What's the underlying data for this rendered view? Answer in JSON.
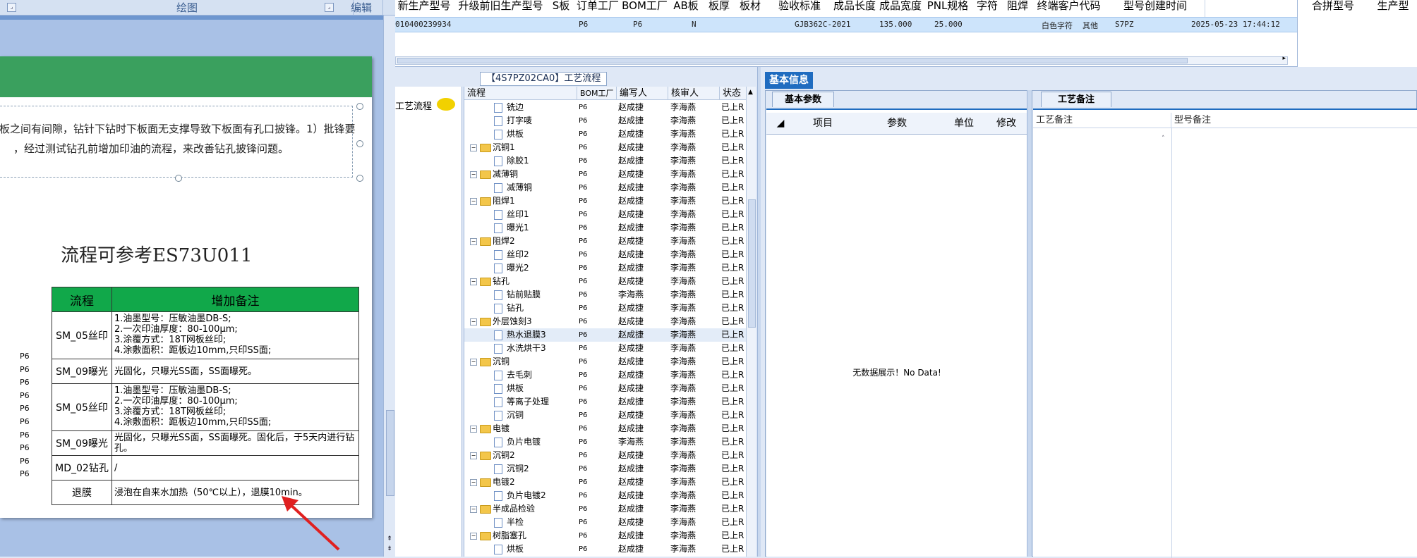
{
  "ribbon": {
    "group_draw": "绘图",
    "group_edit": "编辑"
  },
  "document": {
    "textbox_line1": "板之间有间隙，钻针下钻时下板面无支撑导致下板面有孔口披锋。1）批锋要",
    "textbox_line2": "，经过测试钻孔前增加印油的流程，来改善钻孔披锋问题。",
    "flow_reference": "流程可参考ES73U011",
    "table_headers": {
      "step": "流程",
      "note": "增加备注"
    },
    "table_rows": [
      {
        "step": "SM_05丝印",
        "lines": [
          "1.油墨型号：压敏油墨DB-S;",
          "2.一次印油厚度：80-100μm;",
          "3.涂覆方式：18T网板丝印;",
          "4.涂敷面积：距板边10mm,只印SS面;"
        ]
      },
      {
        "step": "SM_09曝光",
        "lines": [
          "光固化，只曝光SS面，SS面曝死。"
        ]
      },
      {
        "step": "SM_05丝印",
        "lines": [
          "1.油墨型号：压敏油墨DB-S;",
          "2.一次印油厚度：80-100μm;",
          "3.涂覆方式：18T网板丝印;",
          "4.涂敷面积：距板边10mm,只印SS面;"
        ]
      },
      {
        "step": "SM_09曝光",
        "lines": [
          "光固化，只曝光SS面，SS面曝死。固化后，于5天内进行钻孔。"
        ]
      },
      {
        "step": "MD_02钻孔",
        "lines": [
          "/"
        ]
      },
      {
        "step": "退膜",
        "lines": [
          "浸泡在自来水加热（50℃以上），退膜10min。"
        ]
      }
    ],
    "left_p6_values": [
      "P6",
      "P6",
      "P6",
      "P6",
      "P6",
      "P6",
      "P6",
      "P6",
      "P6",
      "P6"
    ]
  },
  "top_grid": {
    "headers": [
      "新生产型号",
      "升级前旧生产型号",
      "S板",
      "订单工厂",
      "BOM工厂",
      "AB板",
      "板厚",
      "板材",
      "验收标准",
      "成品长度",
      "成品宽度",
      "PNL规格",
      "字符",
      "阻焊",
      "终端客户代码",
      "型号创建时间"
    ],
    "row": {
      "new_model": "010400239934",
      "order_factory": "P6",
      "bom_factory": "P6",
      "ab": "N",
      "standard": "GJB362C-2021",
      "length": "135.000",
      "width": "25.000",
      "char": "白色字符",
      "solder": "其他",
      "customer": "S7PZ",
      "created": "2025-05-23 17:44:12"
    },
    "side_headers": [
      "合拼型号",
      "生产型"
    ]
  },
  "tree": {
    "title": "【4S7PZ02CA0】工艺流程",
    "left_label": "工艺流程",
    "headers": [
      "流程",
      "BOM工厂",
      "编写人",
      "核审人",
      "状态"
    ],
    "rows": [
      {
        "level": 2,
        "type": "file",
        "name": "铣边",
        "bom": "P6",
        "writer": "赵成捷",
        "reviewer": "李海燕",
        "status": "已上R"
      },
      {
        "level": 2,
        "type": "file",
        "name": "打字唛",
        "bom": "P6",
        "writer": "赵成捷",
        "reviewer": "李海燕",
        "status": "已上R"
      },
      {
        "level": 2,
        "type": "file",
        "name": "烘板",
        "bom": "P6",
        "writer": "赵成捷",
        "reviewer": "李海燕",
        "status": "已上R"
      },
      {
        "level": 1,
        "type": "folder",
        "name": "沉铜1",
        "bom": "P6",
        "writer": "赵成捷",
        "reviewer": "李海燕",
        "status": "已上R"
      },
      {
        "level": 2,
        "type": "file",
        "name": "除胶1",
        "bom": "P6",
        "writer": "赵成捷",
        "reviewer": "李海燕",
        "status": "已上R"
      },
      {
        "level": 1,
        "type": "folder",
        "name": "减薄铜",
        "bom": "P6",
        "writer": "赵成捷",
        "reviewer": "李海燕",
        "status": "已上R"
      },
      {
        "level": 2,
        "type": "file",
        "name": "减薄铜",
        "bom": "P6",
        "writer": "赵成捷",
        "reviewer": "李海燕",
        "status": "已上R"
      },
      {
        "level": 1,
        "type": "folder",
        "name": "阻焊1",
        "bom": "P6",
        "writer": "赵成捷",
        "reviewer": "李海燕",
        "status": "已上R"
      },
      {
        "level": 2,
        "type": "file",
        "name": "丝印1",
        "bom": "P6",
        "writer": "赵成捷",
        "reviewer": "李海燕",
        "status": "已上R"
      },
      {
        "level": 2,
        "type": "file",
        "name": "曝光1",
        "bom": "P6",
        "writer": "赵成捷",
        "reviewer": "李海燕",
        "status": "已上R"
      },
      {
        "level": 1,
        "type": "folder",
        "name": "阻焊2",
        "bom": "P6",
        "writer": "赵成捷",
        "reviewer": "李海燕",
        "status": "已上R"
      },
      {
        "level": 2,
        "type": "file",
        "name": "丝印2",
        "bom": "P6",
        "writer": "赵成捷",
        "reviewer": "李海燕",
        "status": "已上R"
      },
      {
        "level": 2,
        "type": "file",
        "name": "曝光2",
        "bom": "P6",
        "writer": "赵成捷",
        "reviewer": "李海燕",
        "status": "已上R"
      },
      {
        "level": 1,
        "type": "folder",
        "name": "钻孔",
        "bom": "P6",
        "writer": "赵成捷",
        "reviewer": "李海燕",
        "status": "已上R"
      },
      {
        "level": 2,
        "type": "file",
        "name": "钻前贴膜",
        "bom": "P6",
        "writer": "李海燕",
        "reviewer": "李海燕",
        "status": "已上R"
      },
      {
        "level": 2,
        "type": "file",
        "name": "钻孔",
        "bom": "P6",
        "writer": "赵成捷",
        "reviewer": "李海燕",
        "status": "已上R"
      },
      {
        "level": 1,
        "type": "folder",
        "name": "外层蚀刻3",
        "bom": "P6",
        "writer": "赵成捷",
        "reviewer": "李海燕",
        "status": "已上R"
      },
      {
        "level": 2,
        "type": "file",
        "name": "热水退膜3",
        "bom": "P6",
        "writer": "赵成捷",
        "reviewer": "李海燕",
        "status": "已上R",
        "selected": true
      },
      {
        "level": 2,
        "type": "file",
        "name": "水洗烘干3",
        "bom": "P6",
        "writer": "赵成捷",
        "reviewer": "李海燕",
        "status": "已上R"
      },
      {
        "level": 1,
        "type": "folder",
        "name": "沉铜",
        "bom": "P6",
        "writer": "赵成捷",
        "reviewer": "李海燕",
        "status": "已上R"
      },
      {
        "level": 2,
        "type": "file",
        "name": "去毛刺",
        "bom": "P6",
        "writer": "赵成捷",
        "reviewer": "李海燕",
        "status": "已上R"
      },
      {
        "level": 2,
        "type": "file",
        "name": "烘板",
        "bom": "P6",
        "writer": "赵成捷",
        "reviewer": "李海燕",
        "status": "已上R"
      },
      {
        "level": 2,
        "type": "file",
        "name": "等离子处理",
        "bom": "P6",
        "writer": "赵成捷",
        "reviewer": "李海燕",
        "status": "已上R"
      },
      {
        "level": 2,
        "type": "file",
        "name": "沉铜",
        "bom": "P6",
        "writer": "赵成捷",
        "reviewer": "李海燕",
        "status": "已上R"
      },
      {
        "level": 1,
        "type": "folder",
        "name": "电镀",
        "bom": "P6",
        "writer": "赵成捷",
        "reviewer": "李海燕",
        "status": "已上R"
      },
      {
        "level": 2,
        "type": "file",
        "name": "负片电镀",
        "bom": "P6",
        "writer": "李海燕",
        "reviewer": "李海燕",
        "status": "已上R"
      },
      {
        "level": 1,
        "type": "folder",
        "name": "沉铜2",
        "bom": "P6",
        "writer": "赵成捷",
        "reviewer": "李海燕",
        "status": "已上R"
      },
      {
        "level": 2,
        "type": "file",
        "name": "沉铜2",
        "bom": "P6",
        "writer": "赵成捷",
        "reviewer": "李海燕",
        "status": "已上R"
      },
      {
        "level": 1,
        "type": "folder",
        "name": "电镀2",
        "bom": "P6",
        "writer": "赵成捷",
        "reviewer": "李海燕",
        "status": "已上R"
      },
      {
        "level": 2,
        "type": "file",
        "name": "负片电镀2",
        "bom": "P6",
        "writer": "赵成捷",
        "reviewer": "李海燕",
        "status": "已上R"
      },
      {
        "level": 1,
        "type": "folder",
        "name": "半成品检验",
        "bom": "P6",
        "writer": "赵成捷",
        "reviewer": "李海燕",
        "status": "已上R"
      },
      {
        "level": 2,
        "type": "file",
        "name": "半检",
        "bom": "P6",
        "writer": "赵成捷",
        "reviewer": "李海燕",
        "status": "已上R"
      },
      {
        "level": 1,
        "type": "folder",
        "name": "树脂塞孔",
        "bom": "P6",
        "writer": "赵成捷",
        "reviewer": "李海燕",
        "status": "已上R"
      },
      {
        "level": 2,
        "type": "file",
        "name": "烘板",
        "bom": "P6",
        "writer": "赵成捷",
        "reviewer": "李海燕",
        "status": "已上R"
      }
    ]
  },
  "info": {
    "tab": "基本信息",
    "params_tab": "基本参数",
    "params_headers": [
      "项目",
      "参数",
      "单位",
      "修改"
    ],
    "no_data": "无数据展示！No Data!",
    "notes_tab": "工艺备注",
    "notes_headers": [
      "工艺备注",
      "型号备注"
    ]
  },
  "colors": {
    "accent": "#1f6cc0",
    "selected_row": "#cde4fb",
    "table_header_green": "#11a84a",
    "annotation_arrow": "#e02020"
  }
}
